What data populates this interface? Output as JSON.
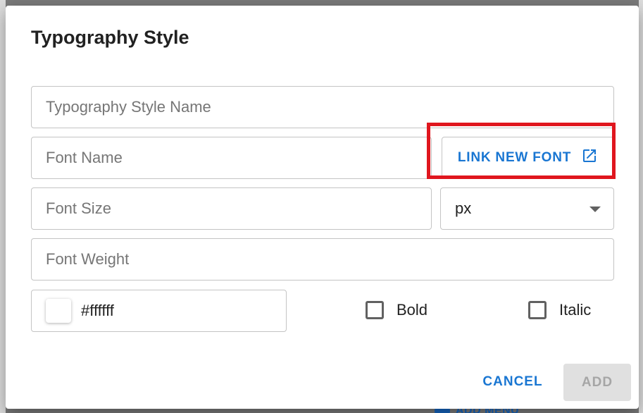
{
  "backdrop": {
    "menu_button_label": "ADD MENU"
  },
  "dialog": {
    "title": "Typography Style",
    "style_name": {
      "placeholder": "Typography Style Name",
      "value": ""
    },
    "font_name": {
      "placeholder": "Font Name",
      "value": ""
    },
    "link_font_button": {
      "label": "LINK NEW FONT",
      "icon": "open-in-new-icon"
    },
    "font_size": {
      "placeholder": "Font Size",
      "value": ""
    },
    "unit_select": {
      "value": "px",
      "icon": "chevron-down-icon"
    },
    "font_weight": {
      "placeholder": "Font Weight",
      "value": ""
    },
    "color": {
      "value": "#ffffff",
      "swatch": "#ffffff"
    },
    "bold_checkbox": {
      "label": "Bold",
      "checked": false
    },
    "italic_checkbox": {
      "label": "Italic",
      "checked": false
    },
    "actions": {
      "cancel": "CANCEL",
      "add": "ADD"
    }
  },
  "colors": {
    "accent": "#1976d2",
    "highlight": "#e0161e",
    "disabled_bg": "#e0e0e0",
    "disabled_text": "#a6a6a6"
  }
}
